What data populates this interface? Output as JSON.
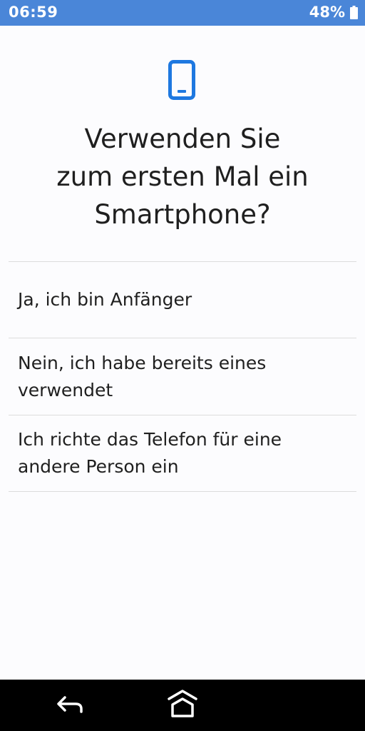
{
  "status_bar": {
    "time": "06:59",
    "battery_percent": "48%",
    "background_color": "#4a86d8",
    "battery_icon": "battery-icon"
  },
  "header": {
    "icon": "smartphone-icon",
    "icon_color": "#1e78e0",
    "title_lines": [
      "Verwenden Sie",
      "zum ersten Mal ein",
      "Smartphone?"
    ]
  },
  "options": [
    {
      "label": "Ja, ich bin Anfänger"
    },
    {
      "label": "Nein, ich habe bereits eines verwendet"
    },
    {
      "label": "Ich richte das Telefon für eine andere Person ein"
    }
  ],
  "nav_bar": {
    "back_icon": "back-icon",
    "home_icon": "home-icon"
  }
}
